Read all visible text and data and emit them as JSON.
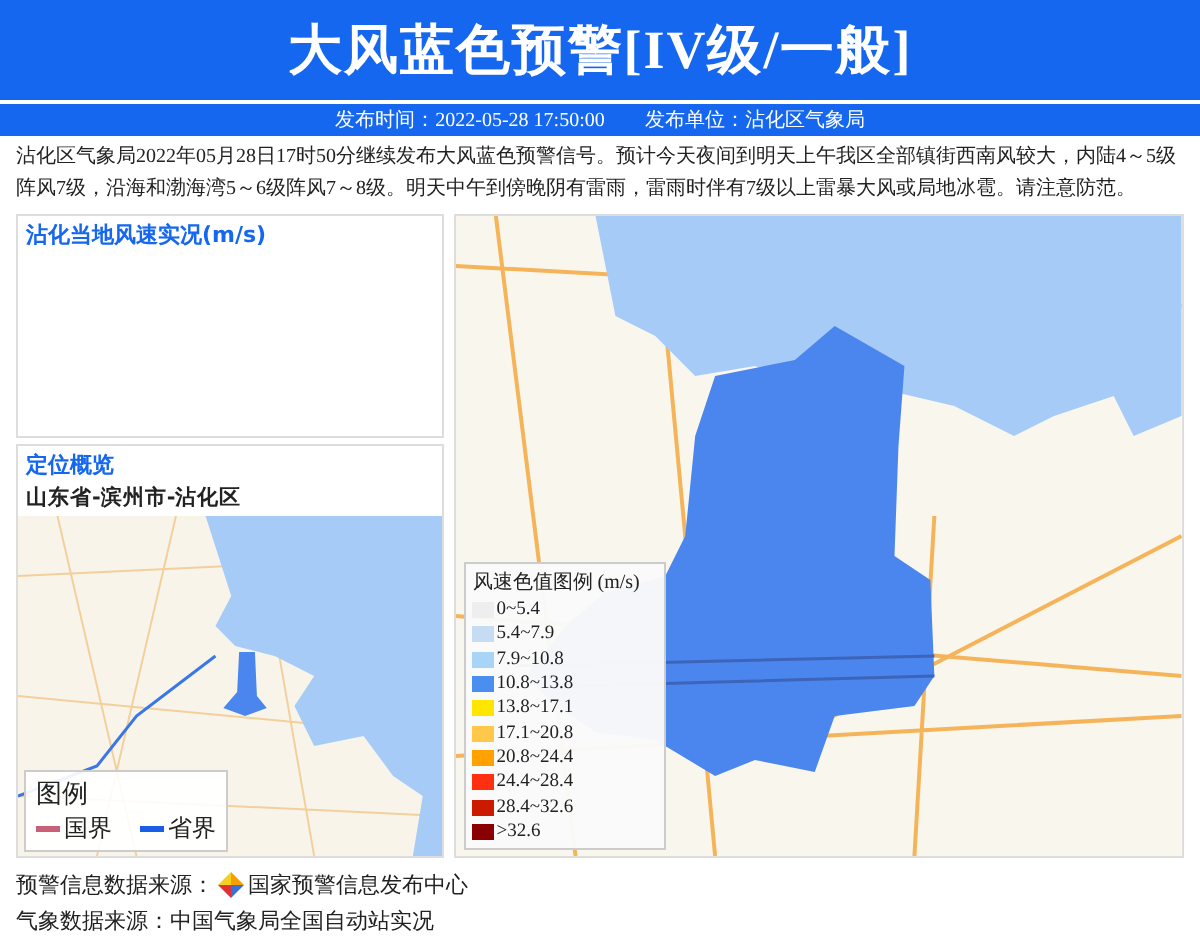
{
  "header": {
    "title": "大风蓝色预警[IV级/一般]",
    "issued_time": "发布时间：2022-05-28 17:50:00",
    "issuer": "发布单位：沾化区气象局"
  },
  "message": "沾化区气象局2022年05月28日17时50分继续发布大风蓝色预警信号。预计今天夜间到明天上午我区全部镇街西南风较大，内陆4～5级阵风7级，沿海和渤海湾5～6级阵风7～8级。明天中午到傍晚阴有雷雨，雷雨时伴有7级以上雷暴大风或局地冰雹。请注意防范。",
  "wind_panel": {
    "title": "沾化当地风速实况(m/s)"
  },
  "location_panel": {
    "title": "定位概览",
    "region": "山东省-滨州市-沾化区",
    "legend": {
      "title": "图例",
      "items": [
        {
          "label": "国界",
          "color": "#c8607a"
        },
        {
          "label": "省界",
          "color": "#1a5ee8"
        }
      ]
    }
  },
  "wind_legend": {
    "title": "风速色值图例 (m/s)",
    "items": [
      {
        "label": "0~5.4",
        "color": "#eeeeee"
      },
      {
        "label": "5.4~7.9",
        "color": "#c6dcf2"
      },
      {
        "label": "7.9~10.8",
        "color": "#a8d4f7"
      },
      {
        "label": "10.8~13.8",
        "color": "#4a8ff0"
      },
      {
        "label": "13.8~17.1",
        "color": "#ffe600"
      },
      {
        "label": "17.1~20.8",
        "color": "#ffc84a"
      },
      {
        "label": "20.8~24.4",
        "color": "#ffa200"
      },
      {
        "label": "24.4~28.4",
        "color": "#ff3010"
      },
      {
        "label": "28.4~32.6",
        "color": "#cc1a00"
      },
      {
        "label": ">32.6",
        "color": "#8a0000"
      }
    ]
  },
  "footer": {
    "warning_source_label": "预警信息数据来源：",
    "warning_source": "国家预警信息发布中心",
    "weather_source": "气象数据来源：中国气象局全国自动站实况"
  }
}
